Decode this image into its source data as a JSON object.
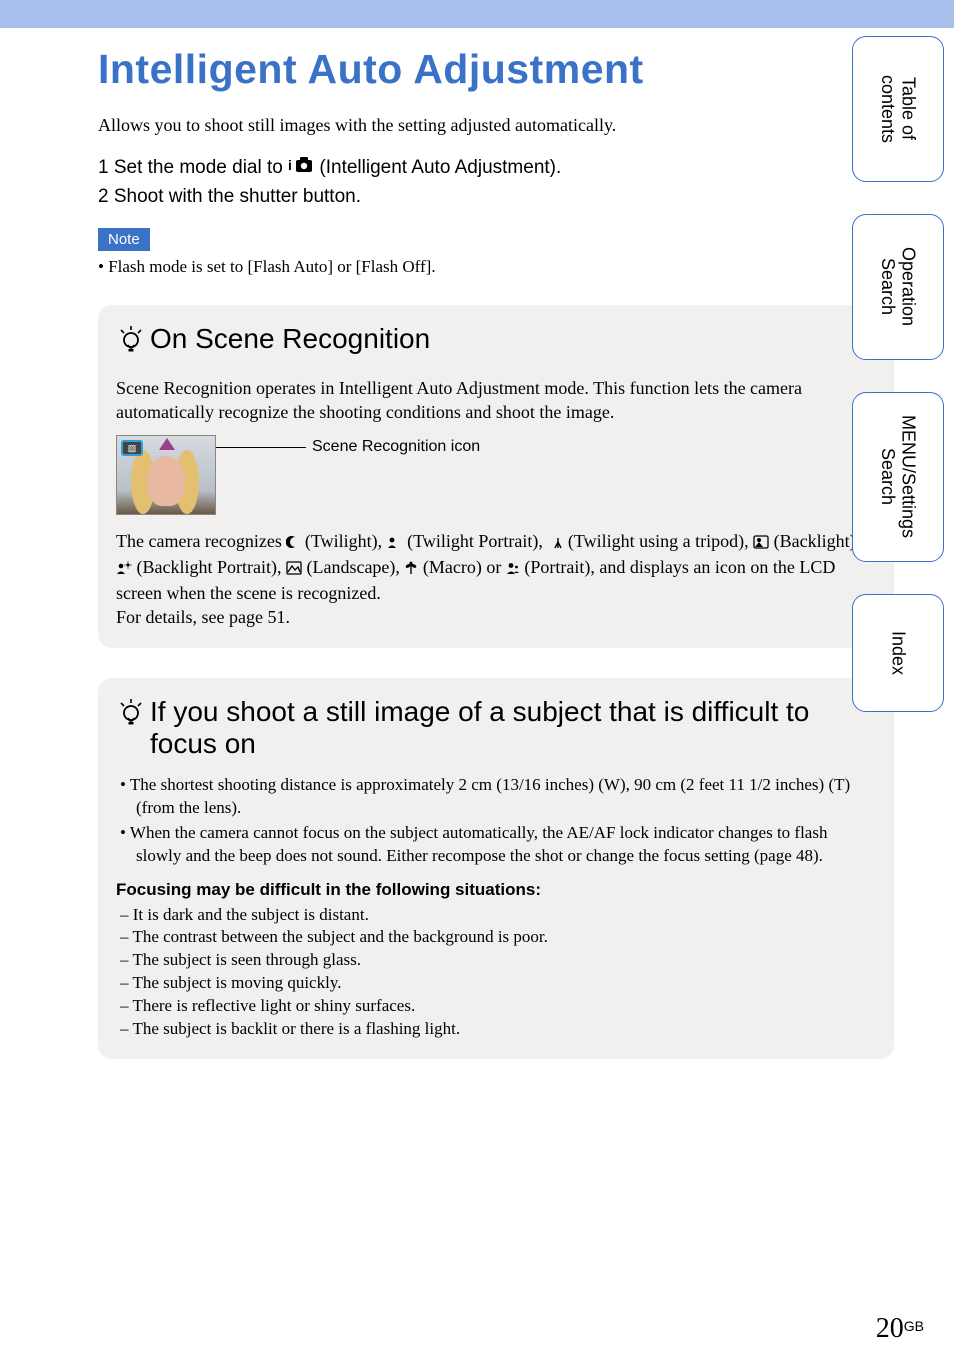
{
  "title": "Intelligent Auto Adjustment",
  "intro": "Allows you to shoot still images with the setting adjusted automatically.",
  "step1_prefix": "1  Set the mode dial to ",
  "step1_suffix": " (Intelligent Auto Adjustment).",
  "step2": "2  Shoot with the shutter button.",
  "note_label": "Note",
  "note_item": "Flash mode is set to [Flash Auto] or [Flash Off].",
  "tip1": {
    "heading": "On Scene Recognition",
    "p1": "Scene Recognition operates in Intelligent Auto Adjustment mode. This function lets the camera automatically recognize the shooting conditions and shoot the image.",
    "leader": "Scene Recognition icon",
    "p2_a": "The camera recognizes ",
    "p2_tw": " (Twilight), ",
    "p2_tp": " (Twilight Portrait), ",
    "p2_tt": " (Twilight using a tripod), ",
    "p2_bl": " (Backlight), ",
    "p2_bp": " (Backlight Portrait), ",
    "p2_ls": " (Landscape), ",
    "p2_mc": " (Macro) or ",
    "p2_pt": " (Portrait), and displays an icon on the LCD screen when the scene is recognized.",
    "p3": "For details, see page 51."
  },
  "tip2": {
    "heading": "If you shoot a still image of a subject that is difficult to focus on",
    "bullets": [
      "The shortest shooting distance is approximately 2 cm (13/16 inches) (W), 90 cm (2 feet 11 1/2 inches) (T) (from the lens).",
      "When the camera cannot focus on the subject automatically, the AE/AF lock indicator changes to flash slowly and the beep does not sound. Either recompose the shot or change the focus setting (page 48)."
    ],
    "focus_heading": "Focusing may be difficult in the following situations:",
    "dashes": [
      "It is dark and the subject is distant.",
      "The contrast between the subject and the background is poor.",
      "The subject is seen through glass.",
      "The subject is moving quickly.",
      "There is reflective light or shiny surfaces.",
      "The subject is backlit or there is a flashing light."
    ]
  },
  "tabs": {
    "toc": "Table of\ncontents",
    "op": "Operation\nSearch",
    "menu": "MENU/Settings\nSearch",
    "index": "Index"
  },
  "page_number": "20",
  "page_suffix": "GB"
}
